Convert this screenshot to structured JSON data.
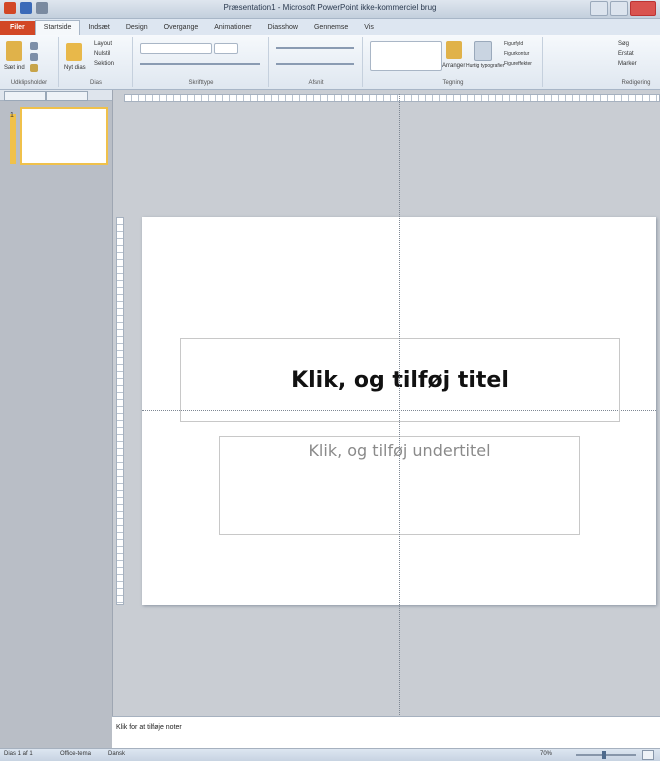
{
  "window": {
    "title": "Præsentation1 - Microsoft PowerPoint ikke-kommerciel brug"
  },
  "ribbon_tabs": [
    "Filer",
    "Startside",
    "Indsæt",
    "Design",
    "Overgange",
    "Animationer",
    "Diasshow",
    "Gennemse",
    "Vis"
  ],
  "ribbon": {
    "groups": [
      "Udklipsholder",
      "Dias",
      "Skrifttype",
      "Afsnit",
      "Tegning",
      "Redigering"
    ],
    "paste_label": "Sæt ind",
    "new_slide_label": "Nyt dias",
    "layout_label": "Layout",
    "reset_label": "Nulstil",
    "section_label": "Sektion",
    "arrange_label": "Arranger",
    "quick_styles_label": "Hurtig typografier",
    "shape_fill_label": "Figurfyld",
    "shape_outline_label": "Figurkontur",
    "shape_effects_label": "Figureffekter",
    "find_label": "Søg",
    "replace_label": "Erstat",
    "select_label": "Marker"
  },
  "thumbnail": {
    "number": "1"
  },
  "slide": {
    "title_placeholder": "Klik, og tilføj titel",
    "subtitle_placeholder": "Klik, og tilføj undertitel"
  },
  "notes": {
    "placeholder": "Klik for at tilføje noter"
  },
  "status": {
    "slide_info": "Dias 1 af 1",
    "theme": "Office-tema",
    "language": "Dansk",
    "zoom": "70%"
  },
  "colors": {
    "file_tab": "#d24726",
    "thumb_highlight": "#f0c14b"
  }
}
